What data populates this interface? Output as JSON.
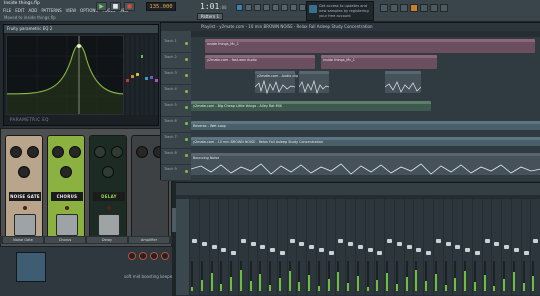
{
  "app": {
    "file_title": "Inside things.flp",
    "hint": "Moved to inside things.flp"
  },
  "menu": [
    "FILE",
    "EDIT",
    "ADD",
    "PATTERNS",
    "VIEW",
    "OPTIONS",
    "TOOLS",
    "HELP"
  ],
  "transport": {
    "tempo": "135.000",
    "time": "1:01",
    "time_sub": ":00",
    "pattern": "Pattern 1"
  },
  "news": {
    "text": "Get access to updates and new samples by registering your free account"
  },
  "eq": {
    "title": "Fruity parametric EQ 2",
    "label": "PARAMETRIC EQ"
  },
  "pedals": [
    {
      "name": "NOISE GATE"
    },
    {
      "name": "CHORUS"
    },
    {
      "name": "DELAY"
    }
  ],
  "pedal_footer": [
    "Noise Gate",
    "Chorus",
    "Delay",
    "Amplifier"
  ],
  "bottom_left": {
    "label": "soft mid boosting keeper"
  },
  "playlist": {
    "title": "Playlist - y2mate.com - 10 min BROWN NOISE · Relax Fall Asleep Study Concentration",
    "tracks": [
      "Track 1",
      "Track 2",
      "Track 3",
      "Track 4",
      "Track 5",
      "Track 6",
      "Track 7",
      "Track 8",
      "Track 9"
    ],
    "clips": [
      {
        "label": "inside things_Mc_1",
        "track": 0
      },
      {
        "label": "y2mate.com - fast.wav Audio",
        "track": 1
      },
      {
        "label": "inside things_Mc_1",
        "track": 1
      },
      {
        "label": "y2mate.com - Audio clip",
        "track": 2
      },
      {
        "label": "y2mate.com - Big Cheap Little things - Alley Rat MIX",
        "track": 4
      },
      {
        "label": "Reverse - Wet Loop",
        "track": 5
      },
      {
        "label": "y2mate.com - 10 min BROWN NOISE - Relax Fall Asleep Study Concentration",
        "track": 7
      },
      {
        "label": "Bouncing Noise",
        "track": 8
      }
    ]
  },
  "colors": {
    "accent": "#f2a94a",
    "play": "#6ee05a",
    "record": "#e3493a",
    "eq_curve": "#9fd24c"
  }
}
